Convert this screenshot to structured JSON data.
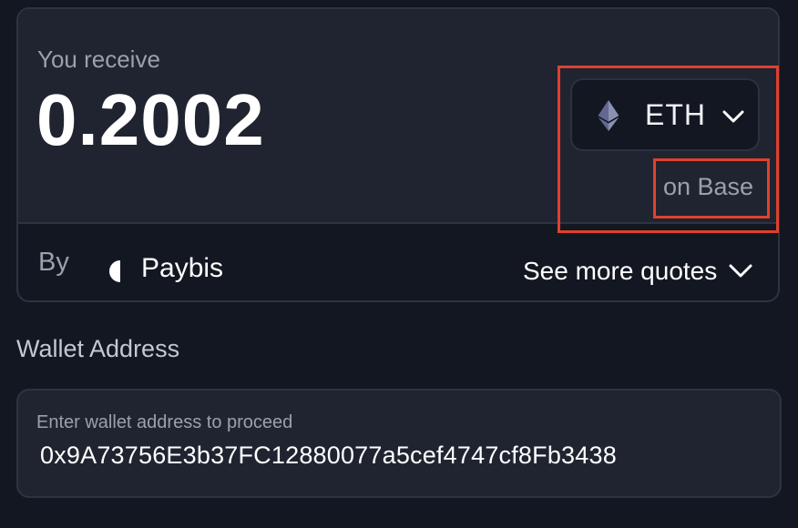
{
  "receive": {
    "label": "You receive",
    "amount": "0.2002",
    "token": {
      "icon": "ethereum-icon",
      "symbol": "ETH"
    },
    "network": "on Base"
  },
  "provider": {
    "by_label": "By",
    "icon": "paybis-logo-icon",
    "name": "Paybis",
    "more_quotes_label": "See more quotes"
  },
  "wallet": {
    "title": "Wallet Address",
    "placeholder": "Enter wallet address to proceed",
    "value": "0x9A73756E3b37FC12880077a5cef4747cf8Fb3438"
  },
  "colors": {
    "background": "#131722",
    "card": "#1f2430",
    "border": "#2e3341",
    "muted_text": "#9aa1ad",
    "highlight": "#e0402f",
    "eth_icon": "#8a92b2"
  }
}
